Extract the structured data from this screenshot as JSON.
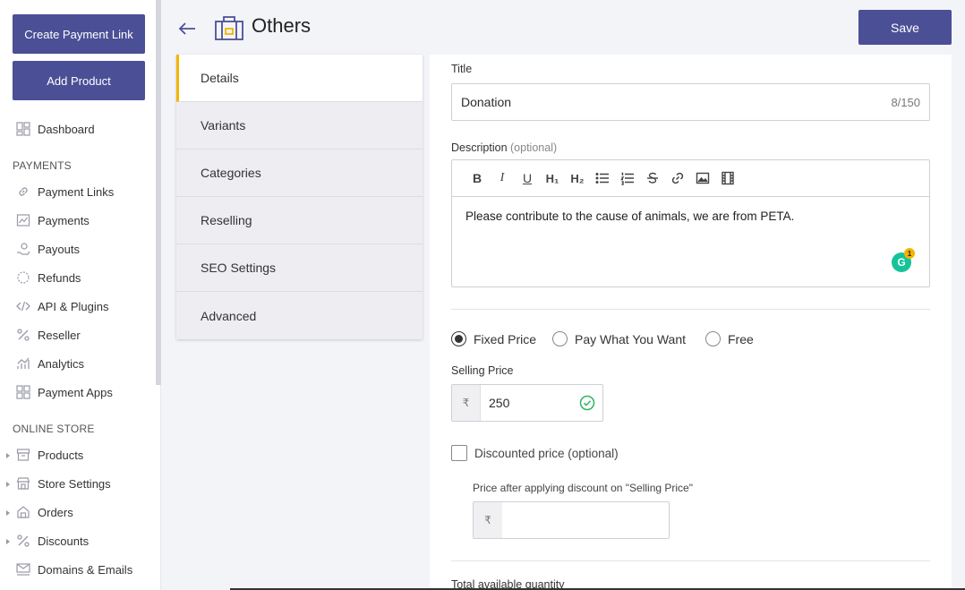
{
  "sidebar": {
    "create_link": "Create Payment Link",
    "add_product": "Add Product",
    "dashboard": "Dashboard",
    "payments_section": "PAYMENTS",
    "payment_items": [
      "Payment Links",
      "Payments",
      "Payouts",
      "Refunds",
      "API & Plugins",
      "Reseller",
      "Analytics",
      "Payment Apps"
    ],
    "store_section": "ONLINE STORE",
    "store_items": [
      "Products",
      "Store Settings",
      "Orders",
      "Discounts",
      "Domains & Emails"
    ]
  },
  "header": {
    "title": "Others",
    "save_label": "Save"
  },
  "tabs": [
    "Details",
    "Variants",
    "Categories",
    "Reselling",
    "SEO Settings",
    "Advanced"
  ],
  "form": {
    "title_label": "Title",
    "title_value": "Donation",
    "title_count": "8/150",
    "description_label": "Description",
    "description_optional": "(optional)",
    "description_text": "Please contribute to the cause of animals, we are from PETA.",
    "toolbar": {
      "bold": "B",
      "italic": "I",
      "underline": "U",
      "h1": "H₁",
      "h2": "H₂"
    },
    "grammarly_count": "1",
    "pricing_options": [
      "Fixed Price",
      "Pay What You Want",
      "Free"
    ],
    "pricing_selected": "Fixed Price",
    "selling_price_label": "Selling Price",
    "currency_symbol": "₹",
    "selling_price_value": "250",
    "discount_label": "Discounted price (optional)",
    "discount_hint": "Price after applying discount on \"Selling Price\"",
    "quantity_label": "Total available quantity"
  },
  "colors": {
    "primary": "#4b4f96",
    "active_tab_accent": "#f4b400",
    "success": "#2fb463",
    "grammarly": "#15c39a"
  }
}
